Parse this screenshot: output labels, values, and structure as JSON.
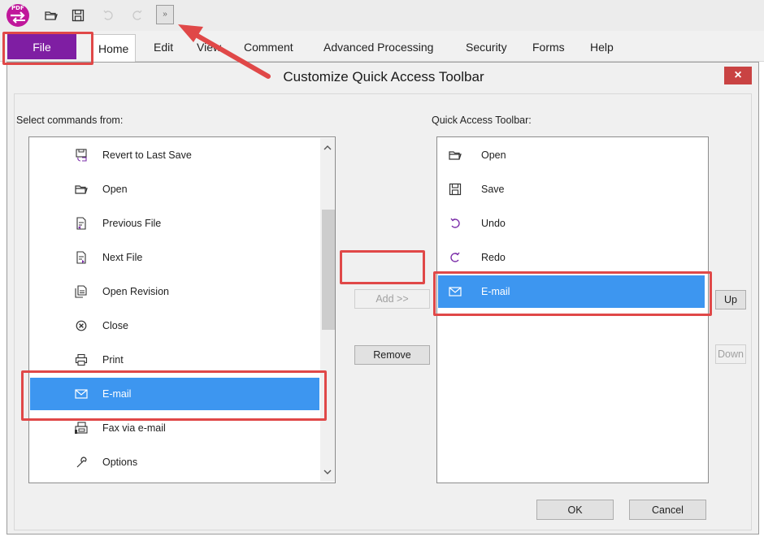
{
  "quick_access": {
    "logo_text": "PDF",
    "icons": [
      "open-folder-icon",
      "save-disk-icon",
      "undo-icon",
      "redo-icon",
      "customize-chevron-icon"
    ],
    "more_glyph": "»"
  },
  "ribbon": {
    "file_label": "File",
    "tabs": [
      {
        "label": "Home"
      },
      {
        "label": "Edit"
      },
      {
        "label": "View"
      },
      {
        "label": "Comment"
      },
      {
        "label": "Advanced Processing"
      },
      {
        "label": "Security"
      },
      {
        "label": "Forms"
      },
      {
        "label": "Help"
      }
    ]
  },
  "dialog": {
    "title": "Customize Quick Access Toolbar",
    "close_glyph": "×",
    "commands_label": "Select commands from:",
    "toolbar_label": "Quick Access Toolbar:",
    "commands": [
      {
        "label": "Revert to Last Save",
        "icon": "revert-icon"
      },
      {
        "label": "Open",
        "icon": "open-folder-icon"
      },
      {
        "label": "Previous File",
        "icon": "previous-file-icon"
      },
      {
        "label": "Next File",
        "icon": "next-file-icon"
      },
      {
        "label": "Open Revision",
        "icon": "open-revision-icon"
      },
      {
        "label": "Close",
        "icon": "close-circle-icon"
      },
      {
        "label": "Print",
        "icon": "printer-icon"
      },
      {
        "label": "E-mail",
        "icon": "envelope-icon",
        "selected": true
      },
      {
        "label": "Fax via e-mail",
        "icon": "fax-icon"
      },
      {
        "label": "Options",
        "icon": "wrench-icon"
      }
    ],
    "toolbar_items": [
      {
        "label": "Open",
        "icon": "open-folder-icon"
      },
      {
        "label": "Save",
        "icon": "save-disk-icon"
      },
      {
        "label": "Undo",
        "icon": "undo-icon"
      },
      {
        "label": "Redo",
        "icon": "redo-icon"
      },
      {
        "label": "E-mail",
        "icon": "envelope-icon",
        "selected": true
      }
    ],
    "buttons": {
      "add": "Add >>",
      "remove": "Remove",
      "up": "Up",
      "down": "Down",
      "ok": "OK",
      "cancel": "Cancel"
    }
  },
  "colors": {
    "file_tab": "#7f1ea3",
    "selection": "#3d96f0",
    "highlight_box": "#e04848",
    "close_button": "#c94343"
  }
}
